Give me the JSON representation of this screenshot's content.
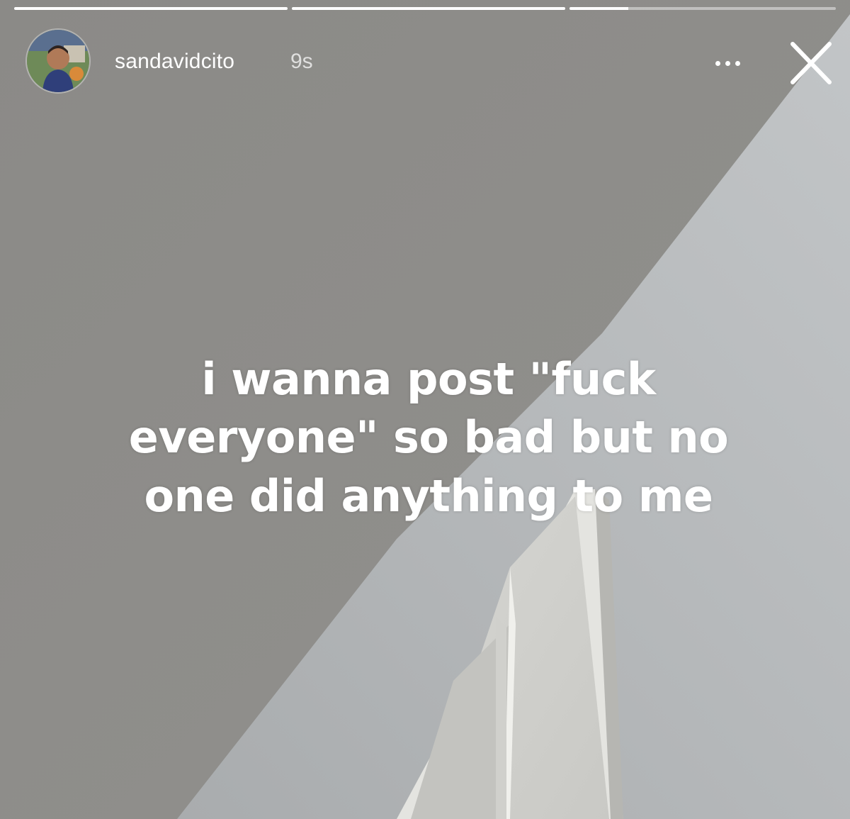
{
  "story": {
    "progress": [
      1,
      1,
      0.22
    ],
    "username": "sandavidcito",
    "timestamp": "9s",
    "caption_lines": [
      "i wanna post \"fuck",
      "everyone\" so bad but no",
      "one did anything to me"
    ]
  },
  "icons": {
    "more": "more-horizontal-icon",
    "close": "close-icon"
  },
  "colors": {
    "text": "#ffffff",
    "ceiling": "#8e8d8a",
    "wall": "#b9bcbe"
  }
}
